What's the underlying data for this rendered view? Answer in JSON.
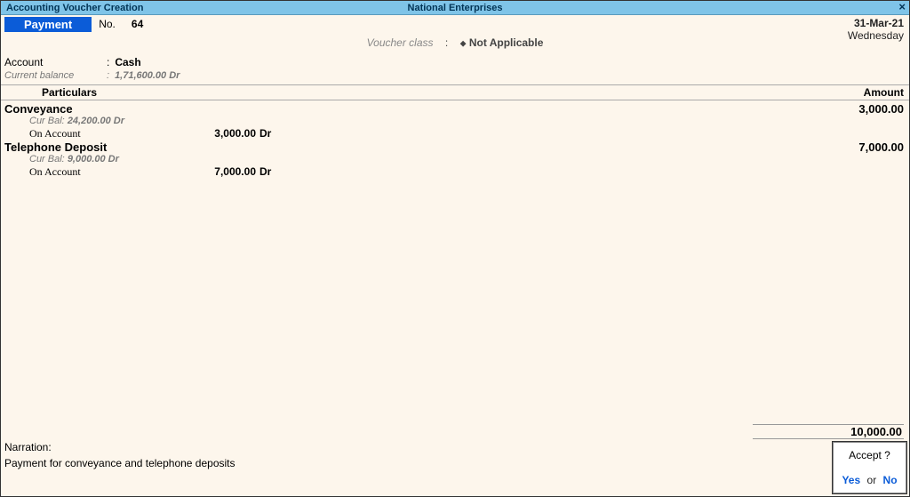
{
  "title_bar": {
    "left": "Accounting Voucher Creation",
    "center": "National Enterprises",
    "close_glyph": "×"
  },
  "header": {
    "voucher_type": "Payment",
    "no_label": "No.",
    "no_value": "64",
    "voucher_class_label": "Voucher class",
    "voucher_class_sep": ":",
    "voucher_class_value": "Not Applicable",
    "date": "31-Mar-21",
    "day": "Wednesday"
  },
  "account": {
    "label": "Account",
    "colon": ":",
    "value": "Cash",
    "balance_label": "Current balance",
    "balance_colon": ":",
    "balance_value": "1,71,600.00 Dr"
  },
  "columns": {
    "particulars": "Particulars",
    "amount": "Amount"
  },
  "entries": [
    {
      "name": "Conveyance",
      "amount": "3,000.00",
      "cur_bal_label": "Cur Bal:",
      "cur_bal_value": "24,200.00 Dr",
      "on_account_label": "On Account",
      "on_account_amount": "3,000.00",
      "on_account_drcr": "Dr"
    },
    {
      "name": "Telephone Deposit",
      "amount": "7,000.00",
      "cur_bal_label": "Cur Bal:",
      "cur_bal_value": "9,000.00 Dr",
      "on_account_label": "On Account",
      "on_account_amount": "7,000.00",
      "on_account_drcr": "Dr"
    }
  ],
  "total": "10,000.00",
  "narration": {
    "label": "Narration:",
    "text": "Payment for conveyance and telephone deposits"
  },
  "accept": {
    "question": "Accept ?",
    "yes": "Yes",
    "or": "or",
    "no": "No"
  }
}
